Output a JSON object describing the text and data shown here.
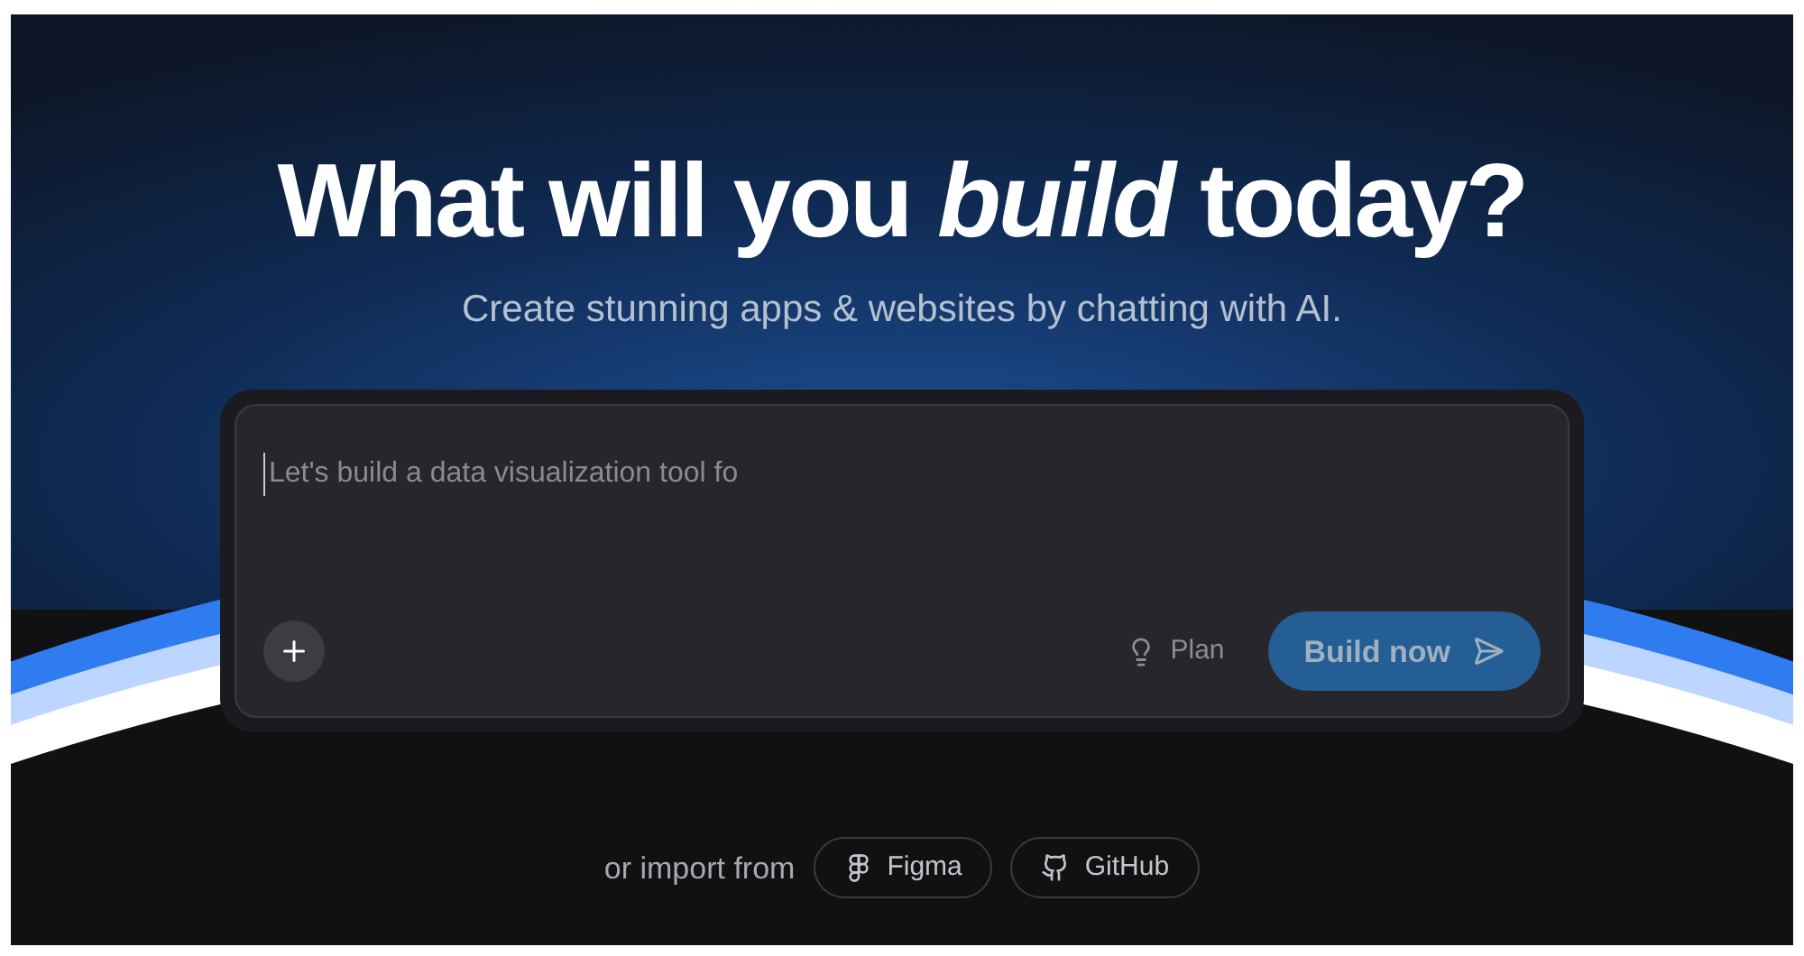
{
  "hero": {
    "headline": "What will you *build* today?",
    "subtitle": "Create stunning apps & websites by chatting with AI."
  },
  "prompt": {
    "placeholder": "Let's build a data visualization tool fo",
    "plan_label": "Plan",
    "submit": {
      "label": "Build now",
      "disabled": true
    }
  },
  "import": {
    "label": "or import from",
    "sources": [
      {
        "kind": "figma",
        "label": "Figma"
      },
      {
        "kind": "github",
        "label": "GitHub"
      }
    ]
  }
}
